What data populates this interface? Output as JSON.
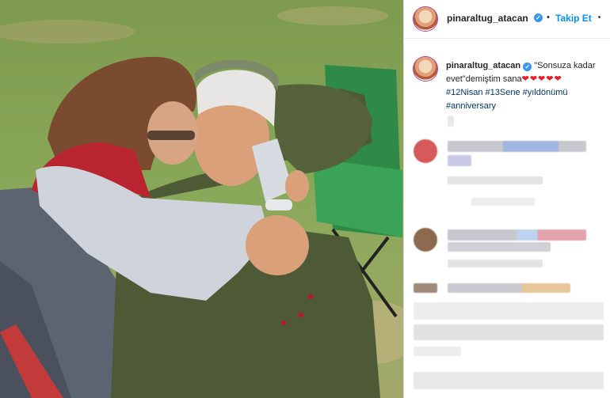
{
  "post": {
    "username": "pinaraltug_atacan",
    "follow_label": "Takip Et",
    "dot": "•",
    "more_label": "⋯"
  },
  "caption": {
    "username": "pinaraltug_atacan",
    "text": "\"Sonsuza kadar evet\"demiştim sana",
    "hearts": "❤❤❤❤❤",
    "hashtags": "#12Nisan #13Sene #yıldönümü #anniversary"
  },
  "colors": {
    "accent": "#0095f6",
    "verified": "#3897f0",
    "hashtag": "#00376b",
    "heart": "#ed1c24"
  }
}
